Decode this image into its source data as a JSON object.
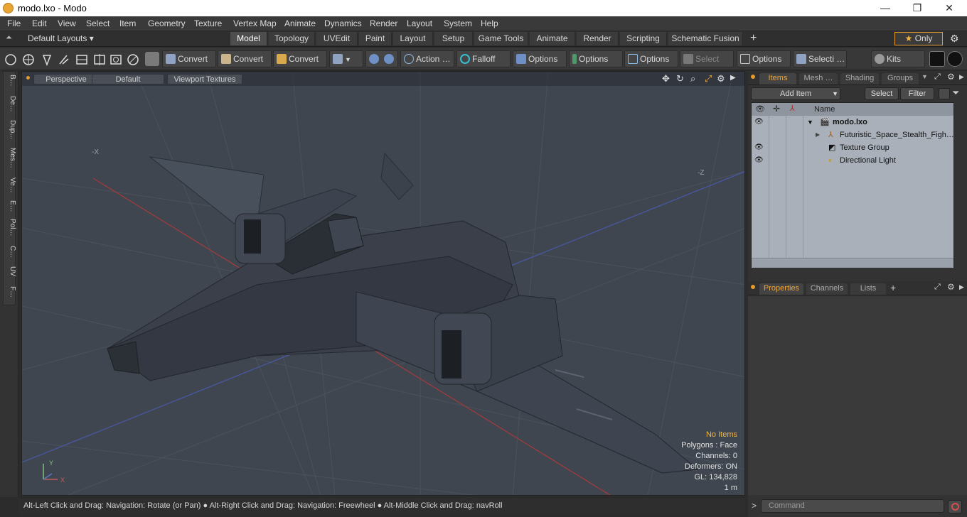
{
  "window": {
    "title": "modo.lxo - Modo",
    "minimize": "—",
    "maximize": "❐",
    "close": "✕"
  },
  "menu": [
    "File",
    "Edit",
    "View",
    "Select",
    "Item",
    "Geometry",
    "Texture",
    "Vertex Map",
    "Animate",
    "Dynamics",
    "Render",
    "Layout",
    "System",
    "Help"
  ],
  "layouts": {
    "default_label": "Default Layouts ▾",
    "tabs": [
      "Model",
      "Topology",
      "UVEdit",
      "Paint",
      "Layout",
      "Setup",
      "Game Tools",
      "Animate",
      "Render",
      "Scripting",
      "Schematic Fusion"
    ],
    "active_tab": "Model",
    "add": "+",
    "only_label": "Only",
    "star": "★",
    "gear": "⚙"
  },
  "toolbar": {
    "convert1": "Convert",
    "convert2": "Convert",
    "convert3": "Convert",
    "action": "Action …",
    "falloff": "Falloff",
    "options1": "Options",
    "options2": "Options",
    "options3": "Options",
    "options4": "Options",
    "select_t": "Select T…",
    "selecti": "Selecti …",
    "kits": "Kits"
  },
  "left_tabs": [
    "B…",
    "De…",
    "Dup…",
    "Mes…",
    "Ve…",
    "E…",
    "Pol…",
    "C…",
    "UV",
    "F…"
  ],
  "viewport": {
    "view": "Perspective",
    "shading": "Default",
    "textures": "Viewport Textures",
    "no_items": "No Items",
    "polygons": "Polygons : Face",
    "channels": "Channels: 0",
    "deformers": "Deformers: ON",
    "gl": "GL: 134,828",
    "scale": "1 m",
    "label_negx": "-X",
    "label_negz": "-Z",
    "axis_y": "Y",
    "axis_x": "X",
    "colors": {
      "bg": "#3f4650",
      "hull": "#3a3f4a",
      "grid_red": "#b23b3b",
      "grid_blue": "#4655a6"
    }
  },
  "status": {
    "text": "Alt-Left Click and Drag: Navigation: Rotate (or Pan) ● Alt-Right Click and Drag: Navigation: Freewheel ● Alt-Middle Click and Drag: navRoll"
  },
  "items_panel": {
    "tabs": [
      "Items",
      "Mesh …",
      "Shading",
      "Groups"
    ],
    "active": "Items",
    "add_item": "Add Item",
    "select": "Select",
    "filter": "Filter",
    "name_col": "Name",
    "rows": [
      {
        "label": "modo.lxo"
      },
      {
        "label": "Futuristic_Space_Stealth_Figh…"
      },
      {
        "label": "Texture Group"
      },
      {
        "label": "Directional Light"
      }
    ]
  },
  "props_panel": {
    "tabs": [
      "Properties",
      "Channels",
      "Lists"
    ],
    "active": "Properties",
    "add": "+"
  },
  "command": {
    "prompt": ">",
    "placeholder": "Command"
  }
}
